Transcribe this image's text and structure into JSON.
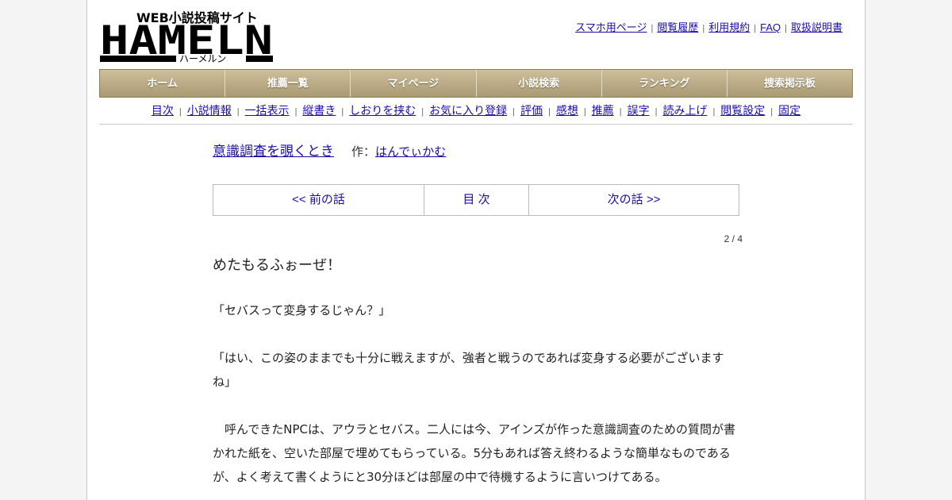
{
  "site": {
    "logo_tagline": "WEB小説投稿サイト",
    "logo_name": "HAMELN",
    "logo_kana": "ハーメルン"
  },
  "toplinks": [
    "スマホ用ページ",
    "閲覧履歴",
    "利用規約",
    "FAQ",
    "取扱説明書"
  ],
  "mainnav": [
    "ホーム",
    "推薦一覧",
    "マイページ",
    "小説検索",
    "ランキング",
    "捜索掲示板"
  ],
  "subnav": [
    "目次",
    "小説情報",
    "一括表示",
    "縦書き",
    "しおりを挟む",
    "お気に入り登録",
    "評価",
    "感想",
    "推薦",
    "誤字",
    "読み上げ",
    "閲覧設定",
    "固定"
  ],
  "novel": {
    "title": "意識調査を覗くとき",
    "author_label": "作：",
    "author": "はんでぃかむ"
  },
  "chapnav": {
    "prev": "<< 前の話",
    "toc": "目 次",
    "next": "次の話 >>"
  },
  "page_number": "2 / 4",
  "chapter_title": "めたもるふぉーぜ！",
  "paragraphs": [
    "「セバスって変身するじゃん？」",
    "「はい、この姿のままでも十分に戦えますが、強者と戦うのであれば変身する必要がございますね」",
    "　呼んできたNPCは、アウラとセバス。二人には今、アインズが作った意識調査のための質問が書かれた紙を、空いた部屋で埋めてもらっている。5分もあれば答え終わるような簡単なものであるが、よく考えて書くようにと30分ほどは部屋の中で待機するように言いつけてある。"
  ]
}
